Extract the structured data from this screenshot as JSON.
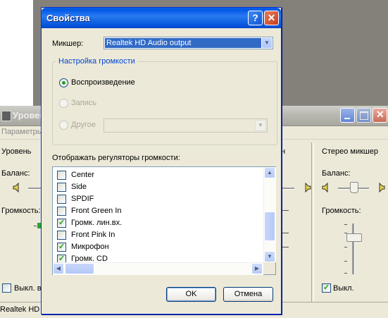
{
  "background_mixer": {
    "title": "Уровен",
    "menu_params": "Параметры",
    "col_level": "Уровень",
    "col_right_partial": "н",
    "col_stereo": "Стерео микшер",
    "balance_label": "Баланс:",
    "volume_label": "Громкость:",
    "mute_left": "Выкл. вс",
    "mute_right": "Выкл.",
    "mute_right_checked": true,
    "status_text": "Realtek HD A"
  },
  "dialog": {
    "title": "Свойства",
    "help_glyph": "?",
    "close_glyph": "✕",
    "mixer_label": "Микшер:",
    "mixer_value": "Realtek HD Audio output",
    "group_title": "Настройка громкости",
    "radio_playback": "Воспроизведение",
    "radio_record": "Запись",
    "radio_other": "Другое",
    "selected_radio": "playback",
    "controls_label": "Отображать регуляторы громкости:",
    "list_items": [
      {
        "label": "Center",
        "checked": false
      },
      {
        "label": "Side",
        "checked": false
      },
      {
        "label": "SPDIF",
        "checked": false
      },
      {
        "label": "Front Green In",
        "checked": false
      },
      {
        "label": "Громк. лин.вх.",
        "checked": true
      },
      {
        "label": "Front Pink In",
        "checked": false
      },
      {
        "label": "Микрофон",
        "checked": true
      },
      {
        "label": "Громк. CD",
        "checked": true
      }
    ],
    "ok_label": "OK",
    "cancel_label": "Отмена"
  },
  "icons": {
    "dropdown": "chevron-down-icon",
    "scroll_up": "arrow-up-icon",
    "scroll_down": "arrow-down-icon",
    "scroll_left": "arrow-left-icon",
    "scroll_right": "arrow-right-icon",
    "speaker": "speaker-icon",
    "help": "help-icon",
    "close": "close-icon"
  },
  "colors": {
    "titlebar_blue": "#0058e6",
    "selection_blue": "#316ac5",
    "group_title_blue": "#0046d5",
    "check_green": "#21a121"
  }
}
